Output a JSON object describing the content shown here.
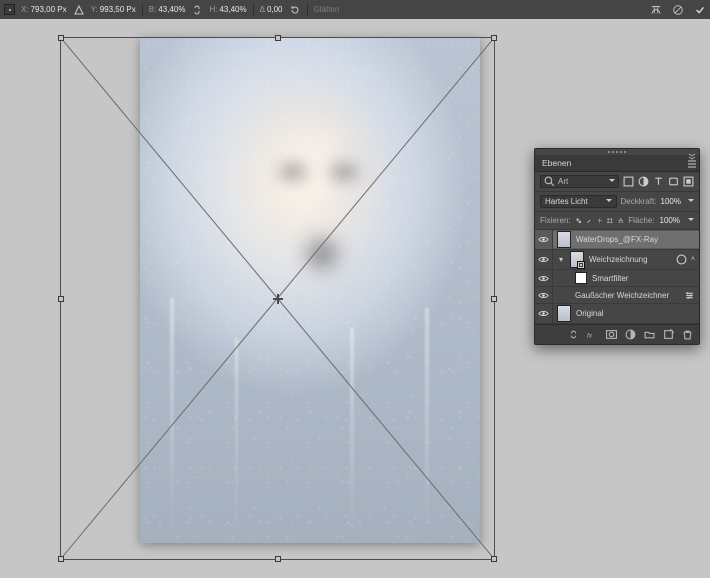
{
  "topbar": {
    "x_label": "X:",
    "x_value": "793,00 Px",
    "y_label": "Y:",
    "y_value": "993,50 Px",
    "w_label": "B:",
    "w_value": "43,40%",
    "h_label": "H:",
    "h_value": "43,40%",
    "angle_label": "Δ",
    "angle_value": "0,00",
    "antialias_label": "Glätten"
  },
  "panel": {
    "title": "Ebenen",
    "search_label": "Art",
    "blend_mode": "Hartes Licht",
    "opacity_label": "Deckkraft:",
    "opacity_value": "100%",
    "lock_label": "Fixieren:",
    "fill_label": "Fläche:",
    "fill_value": "100%",
    "layers": [
      {
        "name": "WaterDrops_@FX-Ray"
      },
      {
        "name": "Weichzeichnung"
      },
      {
        "name": "Smartfilter"
      },
      {
        "name": "Gaußscher Weichzeichner"
      },
      {
        "name": "Original"
      }
    ]
  }
}
